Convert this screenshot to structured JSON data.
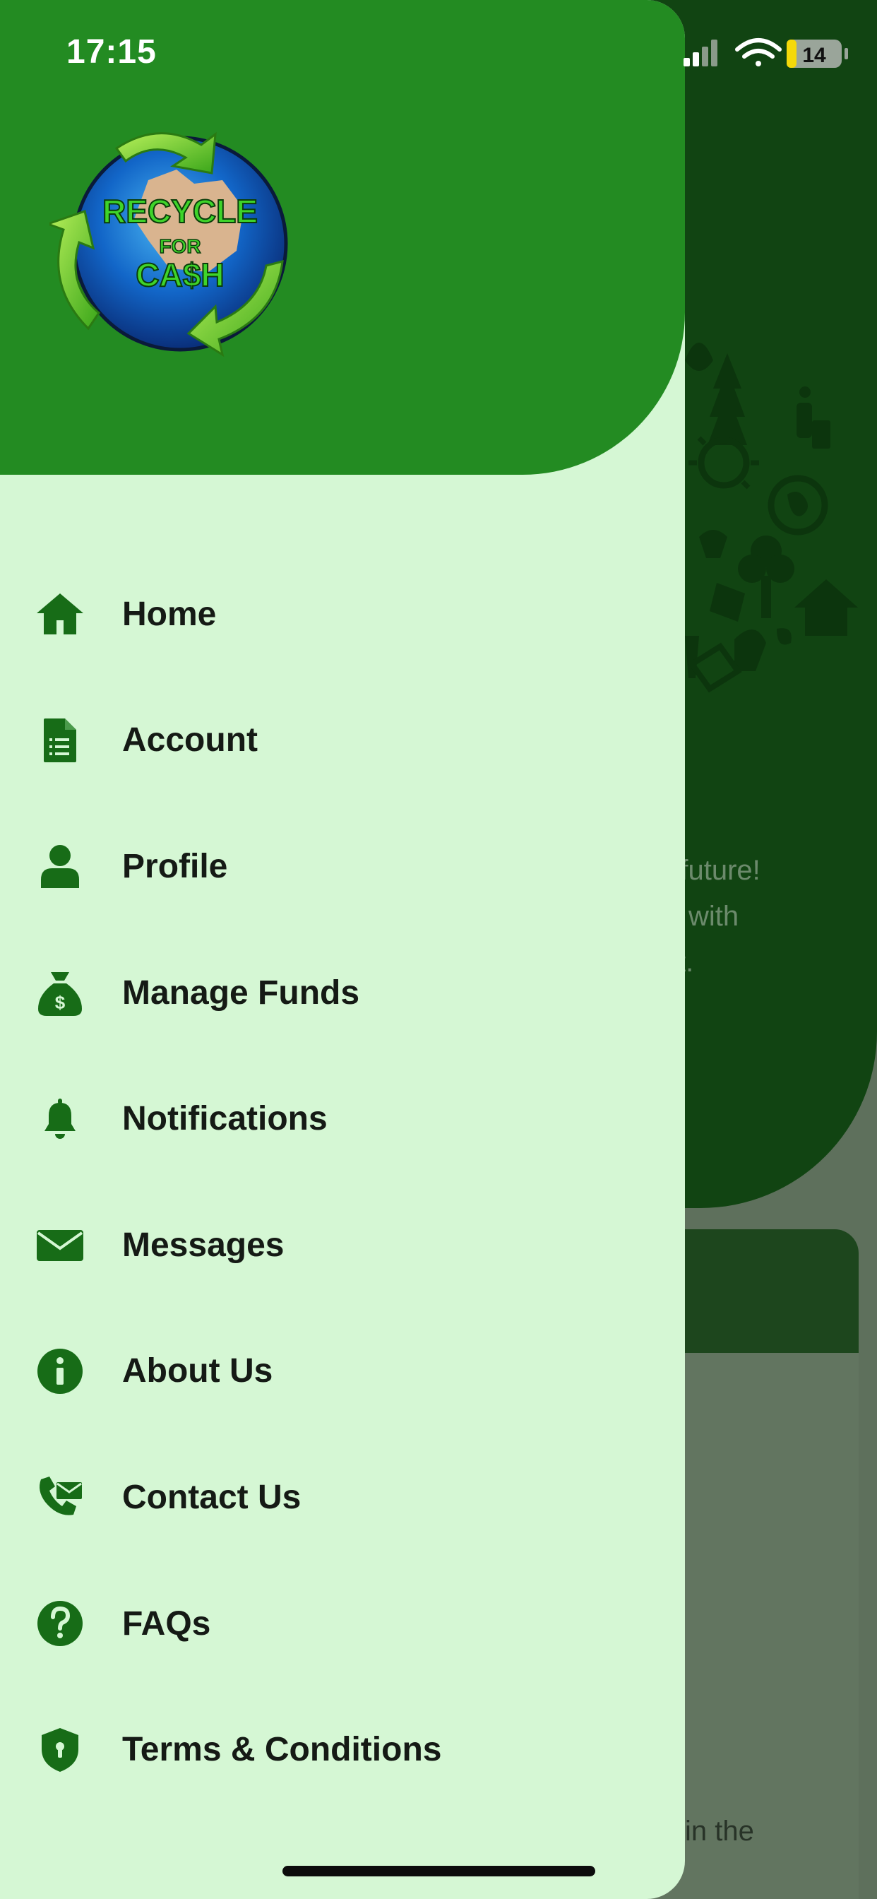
{
  "status_bar": {
    "time": "17:15",
    "battery": "14"
  },
  "background_screen": {
    "text_line_1": "e future!",
    "text_line_2": "with",
    "text_line_3": "t.",
    "text_line_4": "in the"
  },
  "logo": {
    "text_top": "RECYCLE",
    "text_middle": "FOR",
    "text_bottom": "CA$H"
  },
  "menu": {
    "items": [
      {
        "label": "Home",
        "icon": "home-icon"
      },
      {
        "label": "Account",
        "icon": "document-icon"
      },
      {
        "label": "Profile",
        "icon": "user-icon"
      },
      {
        "label": "Manage Funds",
        "icon": "money-bag-icon"
      },
      {
        "label": "Notifications",
        "icon": "bell-icon"
      },
      {
        "label": "Messages",
        "icon": "envelope-icon"
      },
      {
        "label": "About Us",
        "icon": "info-icon"
      },
      {
        "label": "Contact Us",
        "icon": "contact-icon"
      },
      {
        "label": "FAQs",
        "icon": "question-icon"
      },
      {
        "label": "Terms & Conditions",
        "icon": "shield-icon"
      }
    ]
  },
  "colors": {
    "drawer_bg": "#d5f7d4",
    "header_green": "#238b22",
    "icon_green": "#176c17",
    "label_text": "#151a15"
  }
}
